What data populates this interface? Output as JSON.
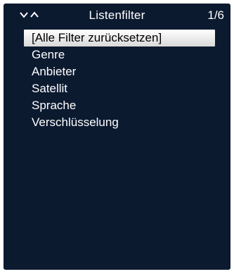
{
  "header": {
    "nav_icon": "chevron-down-up-icon",
    "title": "Listenfilter",
    "page_indicator": "1/6"
  },
  "menu": {
    "selected_index": 0,
    "items": [
      {
        "label": "[Alle Filter zurücksetzen]"
      },
      {
        "label": "Genre"
      },
      {
        "label": "Anbieter"
      },
      {
        "label": "Satellit"
      },
      {
        "label": "Sprache"
      },
      {
        "label": "Verschlüsselung"
      }
    ]
  },
  "colors": {
    "background": "#0c1a30",
    "text": "#ffffff",
    "highlight": "#ffffff",
    "highlight_text": "#000000"
  }
}
